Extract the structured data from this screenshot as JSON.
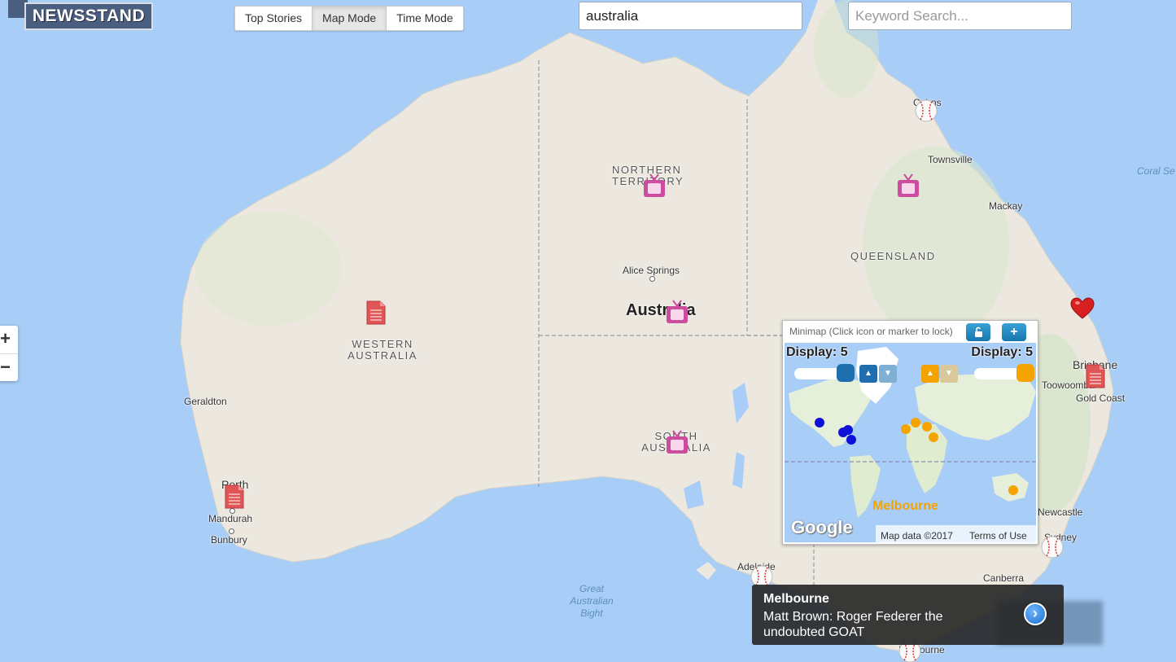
{
  "app": {
    "logo_text": "NEWSSTAND"
  },
  "mode_tabs": [
    {
      "label": "Top Stories",
      "active": false
    },
    {
      "label": "Map Mode",
      "active": true
    },
    {
      "label": "Time Mode",
      "active": false
    }
  ],
  "location_search": {
    "value": "australia"
  },
  "keyword_search": {
    "value": "",
    "placeholder": "Keyword Search..."
  },
  "zoom": {
    "in_label": "+",
    "out_label": "−"
  },
  "map_labels": {
    "country": "Australia",
    "northern_territory": "NORTHERN TERRITORY",
    "queensland": "QUEENSLAND",
    "western_australia": "WESTERN AUSTRALIA",
    "south_australia": "SOUTH AUSTRALIA",
    "alice_springs": "Alice Springs",
    "townsville": "Townsville",
    "mackay": "Mackay",
    "cairns": "Cairns",
    "brisbane": "Brisbane",
    "toowoomba": "Toowoomba",
    "gold_coast": "Gold Coast",
    "newcastle": "Newcastle",
    "sydney": "Sydney",
    "canberra": "Canberra",
    "adelaide": "Adelaide",
    "melbourne": "Melbourne",
    "geraldton": "Geraldton",
    "perth": "Perth",
    "mandurah": "Mandurah",
    "bunbury": "Bunbury",
    "great_australian_bight": "Great Australian Bight",
    "coral_sea": "Coral Se"
  },
  "markers": [
    {
      "type": "tv-icon"
    },
    {
      "type": "tv-icon"
    },
    {
      "type": "tv-icon"
    },
    {
      "type": "tv-icon"
    },
    {
      "type": "document-icon"
    },
    {
      "type": "document-icon"
    },
    {
      "type": "document-icon"
    },
    {
      "type": "heart-icon"
    },
    {
      "type": "baseball-icon"
    },
    {
      "type": "baseball-icon"
    },
    {
      "type": "baseball-icon"
    },
    {
      "type": "baseball-icon"
    }
  ],
  "minimap": {
    "title": "Minimap (Click icon or marker to lock)",
    "lock_icon": "unlock-icon",
    "add_icon": "plus-icon",
    "add_label": "+",
    "left_display": "Display: 5",
    "right_display": "Display: 5",
    "left_color": "#1f6fb0",
    "right_color": "#f5a300",
    "highlight_label": "Melbourne",
    "google_label": "Google",
    "map_data": "Map data ©2017",
    "terms": "Terms of Use"
  },
  "popup": {
    "location": "Melbourne",
    "headline": "Matt Brown: Roger Federer the undoubted GOAT",
    "go_icon": "chevron-right-icon",
    "go_label": "›"
  },
  "colors": {
    "ocean": "#a8cdf7",
    "land": "#ede9e0",
    "tv_marker": "#cc4d9e",
    "doc_marker": "#e05555",
    "heart_marker": "#d92020"
  }
}
